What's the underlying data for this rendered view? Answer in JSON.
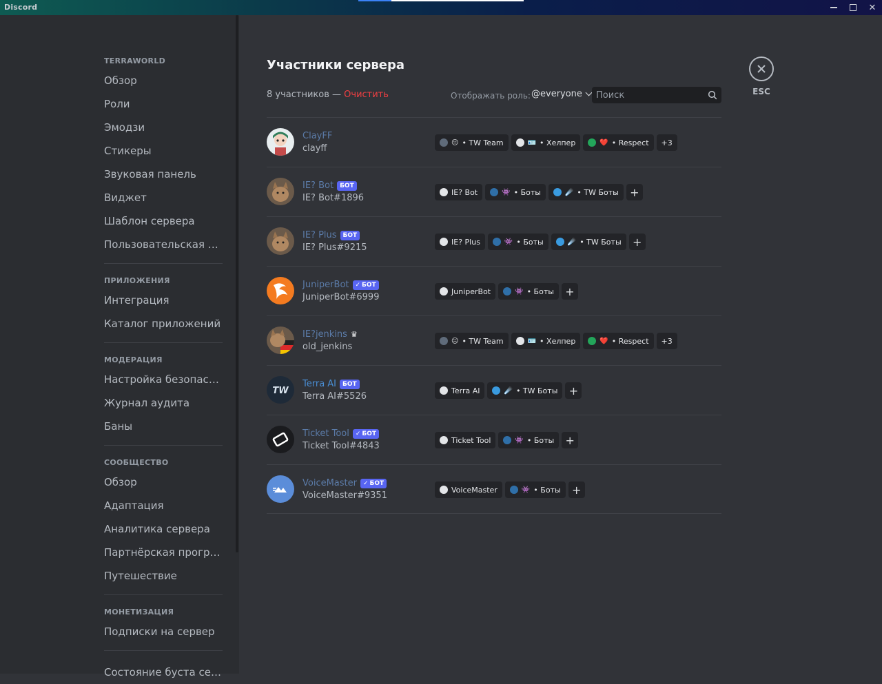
{
  "window": {
    "app_name": "Discord",
    "controls": [
      "minimize",
      "maximize",
      "close"
    ]
  },
  "sidebar": {
    "sections": [
      {
        "header": "TERRAWORLD",
        "items": [
          "Обзор",
          "Роли",
          "Эмодзи",
          "Стикеры",
          "Звуковая панель",
          "Виджет",
          "Шаблон сервера",
          "Пользовательская сс..."
        ]
      },
      {
        "header": "ПРИЛОЖЕНИЯ",
        "items": [
          "Интеграция",
          "Каталог приложений"
        ]
      },
      {
        "header": "МОДЕРАЦИЯ",
        "items": [
          "Настройка безопасно...",
          "Журнал аудита",
          "Баны"
        ]
      },
      {
        "header": "СООБЩЕСТВО",
        "items": [
          "Обзор",
          "Адаптация",
          "Аналитика сервера",
          "Партнёрская програм...",
          "Путешествие"
        ]
      },
      {
        "header": "МОНЕТИЗАЦИЯ",
        "items": [
          "Подписки на сервер"
        ]
      },
      {
        "header": "",
        "items": [
          "Состояние буста сервера"
        ]
      }
    ]
  },
  "main": {
    "title": "Участники сервера",
    "count_text": "8 участников — ",
    "clear_label": "Очистить",
    "role_filter_label": "Отображать роль:",
    "role_filter_value": "@everyone",
    "search_placeholder": "Поиск",
    "close_label": "ESC"
  },
  "members": [
    {
      "name": "ClayFF",
      "tag": "clayff",
      "badge": "",
      "crown": false,
      "roles": [
        {
          "color": "#5f6b7a",
          "emoji": "😐",
          "label": "• TW Team"
        },
        {
          "color": "#e3e5e8",
          "emoji": "🪪",
          "label": "• Хелпер"
        },
        {
          "color": "#23a55a",
          "emoji": "❤️",
          "label": "• Respect"
        }
      ],
      "more": "+3",
      "plus": false
    },
    {
      "name": "IE? Bot",
      "tag": "IE? Bot#1896",
      "badge": "БОТ",
      "verified": false,
      "crown": false,
      "roles": [
        {
          "color": "#e3e5e8",
          "emoji": "",
          "label": "IE? Bot"
        },
        {
          "color": "#2f6fa8",
          "emoji": "👾",
          "label": "• Боты"
        },
        {
          "color": "#3a9be0",
          "emoji": "☄️",
          "label": "• TW Боты"
        }
      ],
      "more": "",
      "plus": true
    },
    {
      "name": "IE? Plus",
      "tag": "IE? Plus#9215",
      "badge": "БОТ",
      "verified": false,
      "crown": false,
      "roles": [
        {
          "color": "#e3e5e8",
          "emoji": "",
          "label": "IE? Plus"
        },
        {
          "color": "#2f6fa8",
          "emoji": "👾",
          "label": "• Боты"
        },
        {
          "color": "#3a9be0",
          "emoji": "☄️",
          "label": "• TW Боты"
        }
      ],
      "more": "",
      "plus": true
    },
    {
      "name": "JuniperBot",
      "tag": "JuniperBot#6999",
      "badge": "БОТ",
      "verified": true,
      "crown": false,
      "roles": [
        {
          "color": "#e3e5e8",
          "emoji": "",
          "label": "JuniperBot"
        },
        {
          "color": "#2f6fa8",
          "emoji": "👾",
          "label": "• Боты"
        }
      ],
      "more": "",
      "plus": true
    },
    {
      "name": "IE?jenkins",
      "tag": "old_jenkins",
      "badge": "",
      "crown": true,
      "roles": [
        {
          "color": "#5f6b7a",
          "emoji": "😐",
          "label": "• TW Team"
        },
        {
          "color": "#e3e5e8",
          "emoji": "🪪",
          "label": "• Хелпер"
        },
        {
          "color": "#23a55a",
          "emoji": "❤️",
          "label": "• Respect"
        }
      ],
      "more": "+3",
      "plus": false
    },
    {
      "name": "Terra AI",
      "tag": "Terra AI#5526",
      "badge": "БОТ",
      "verified": false,
      "crown": false,
      "bright": true,
      "roles": [
        {
          "color": "#e3e5e8",
          "emoji": "",
          "label": "Terra AI"
        },
        {
          "color": "#3a9be0",
          "emoji": "☄️",
          "label": "• TW Боты"
        }
      ],
      "more": "",
      "plus": true
    },
    {
      "name": "Ticket Tool",
      "tag": "Ticket Tool#4843",
      "badge": "БОТ",
      "verified": true,
      "crown": false,
      "roles": [
        {
          "color": "#e3e5e8",
          "emoji": "",
          "label": "Ticket Tool"
        },
        {
          "color": "#2f6fa8",
          "emoji": "👾",
          "label": "• Боты"
        }
      ],
      "more": "",
      "plus": true
    },
    {
      "name": "VoiceMaster",
      "tag": "VoiceMaster#9351",
      "badge": "БОТ",
      "verified": true,
      "crown": false,
      "roles": [
        {
          "color": "#e3e5e8",
          "emoji": "",
          "label": "VoiceMaster"
        },
        {
          "color": "#2f6fa8",
          "emoji": "👾",
          "label": "• Боты"
        }
      ],
      "more": "",
      "plus": true
    }
  ]
}
